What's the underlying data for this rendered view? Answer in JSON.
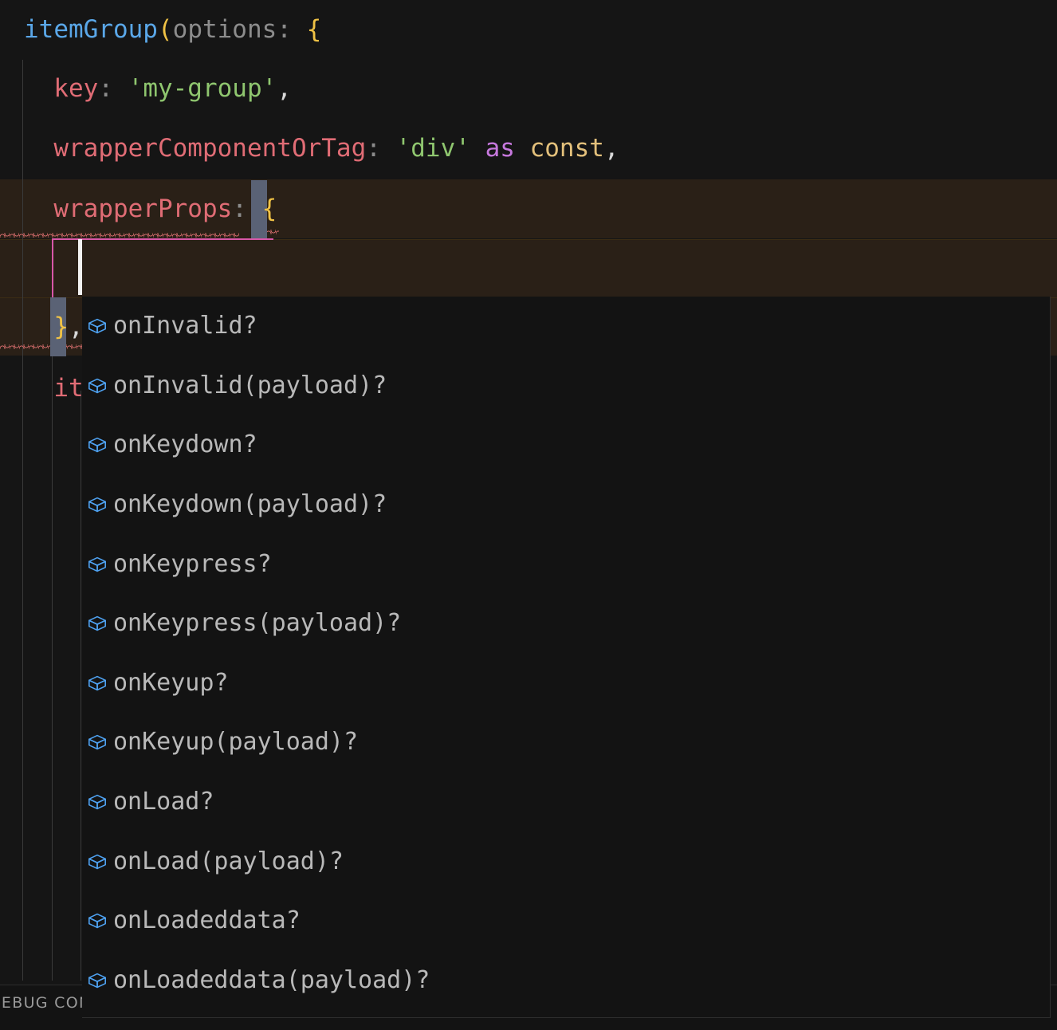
{
  "app": {
    "kind": "code-editor",
    "theme": "dark"
  },
  "colors": {
    "editor_background": "#151515",
    "error_line_background": "#2a2017",
    "squiggle_error": "#d06a6a",
    "cursor_line_border": "#d857a8",
    "caret": "#f2f2f2",
    "bracket_match_background": "#5a6275",
    "suggest_background": "#131313",
    "suggest_border": "#2e2e2e",
    "suggest_label": "#b9b9b9",
    "suggest_icon": "#4ea1f0",
    "token_function": "#5aa7e8",
    "token_punctuation": "#f0c245",
    "token_parameter": "#8c8c8c",
    "token_property": "#e06c75",
    "token_string": "#8fc66f",
    "token_keyword": "#c678dd",
    "token_type": "#e3c07b",
    "indent_guide": "#3a3a3a"
  },
  "editor": {
    "lines": [
      {
        "id": "line-1",
        "tokens": [
          {
            "text": "itemGroup",
            "cls": "t-fn"
          },
          {
            "text": "(",
            "cls": "t-punct"
          },
          {
            "text": "options: ",
            "cls": "t-param"
          },
          {
            "text": "{",
            "cls": "t-punct"
          }
        ]
      },
      {
        "id": "line-2",
        "tokens": [
          {
            "text": "  ",
            "cls": "t-plain"
          },
          {
            "text": "key",
            "cls": "t-prop"
          },
          {
            "text": ": ",
            "cls": "t-param"
          },
          {
            "text": "'my-group'",
            "cls": "t-str"
          },
          {
            "text": ",",
            "cls": "t-plain"
          }
        ]
      },
      {
        "id": "line-3",
        "tokens": [
          {
            "text": "  ",
            "cls": "t-plain"
          },
          {
            "text": "wrapperComponentOrTag",
            "cls": "t-prop"
          },
          {
            "text": ": ",
            "cls": "t-param"
          },
          {
            "text": "'div'",
            "cls": "t-str"
          },
          {
            "text": " ",
            "cls": "t-plain"
          },
          {
            "text": "as",
            "cls": "t-kw"
          },
          {
            "text": " ",
            "cls": "t-plain"
          },
          {
            "text": "const",
            "cls": "t-type"
          },
          {
            "text": ",",
            "cls": "t-plain"
          }
        ]
      },
      {
        "id": "line-4",
        "tokens": [
          {
            "text": "  ",
            "cls": "t-plain"
          },
          {
            "text": "wrapperProps",
            "cls": "t-prop"
          },
          {
            "text": ": ",
            "cls": "t-param"
          },
          {
            "text": "{",
            "cls": "t-punct"
          }
        ]
      },
      {
        "id": "line-5",
        "tokens": [
          {
            "text": "    ",
            "cls": "t-plain"
          }
        ]
      },
      {
        "id": "line-6",
        "tokens": [
          {
            "text": "  ",
            "cls": "t-plain"
          },
          {
            "text": "}",
            "cls": "t-punct"
          },
          {
            "text": ",",
            "cls": "t-plain"
          }
        ]
      },
      {
        "id": "line-7",
        "tokens": [
          {
            "text": "  ",
            "cls": "t-plain"
          },
          {
            "text": "it",
            "cls": "t-prop"
          }
        ]
      }
    ]
  },
  "suggest": {
    "items": [
      {
        "label": "onInvalid?",
        "icon": "property-cube-icon"
      },
      {
        "label": "onInvalid(payload)?",
        "icon": "property-cube-icon"
      },
      {
        "label": "onKeydown?",
        "icon": "property-cube-icon"
      },
      {
        "label": "onKeydown(payload)?",
        "icon": "property-cube-icon"
      },
      {
        "label": "onKeypress?",
        "icon": "property-cube-icon"
      },
      {
        "label": "onKeypress(payload)?",
        "icon": "property-cube-icon"
      },
      {
        "label": "onKeyup?",
        "icon": "property-cube-icon"
      },
      {
        "label": "onKeyup(payload)?",
        "icon": "property-cube-icon"
      },
      {
        "label": "onLoad?",
        "icon": "property-cube-icon"
      },
      {
        "label": "onLoad(payload)?",
        "icon": "property-cube-icon"
      },
      {
        "label": "onLoadeddata?",
        "icon": "property-cube-icon"
      },
      {
        "label": "onLoadeddata(payload)?",
        "icon": "property-cube-icon"
      }
    ]
  },
  "panel": {
    "tab_label": "DEBUG CONSOLE"
  }
}
